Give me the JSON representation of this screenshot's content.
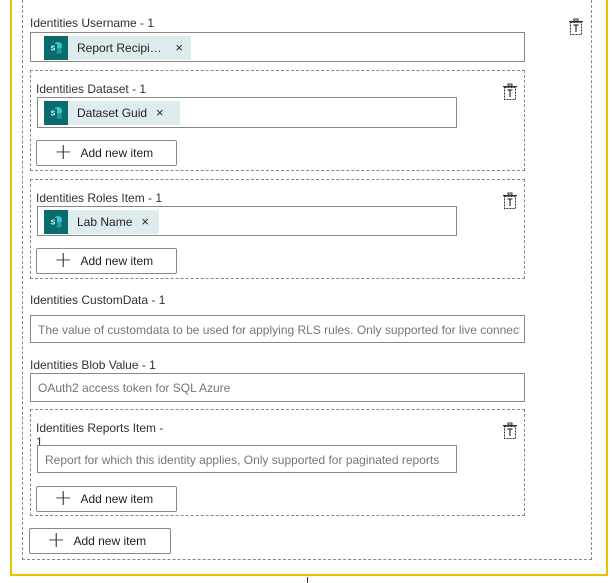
{
  "username": {
    "label": "Identities Username - 1",
    "chip": {
      "text": "Report Recipie…",
      "close": "×"
    }
  },
  "dataset": {
    "label": "Identities Dataset - 1",
    "chip": {
      "text": "Dataset Guid",
      "close": "×"
    },
    "add_label": "Add new item"
  },
  "roles": {
    "label": "Identities Roles Item - 1",
    "chip": {
      "text": "Lab Name",
      "close": "×"
    },
    "add_label": "Add new item"
  },
  "customdata": {
    "label": "Identities CustomData - 1",
    "placeholder": "The value of customdata to be used for applying RLS rules. Only supported for live connections"
  },
  "blob": {
    "label": "Identities Blob Value - 1",
    "placeholder": "OAuth2 access token for SQL Azure"
  },
  "reports": {
    "label": "Identities Reports Item - 1",
    "placeholder": "Report for which this identity applies, Only supported for paginated reports",
    "add_label": "Add new item"
  },
  "outer_add_label": "Add new item",
  "icons": {
    "delete": "delete-icon",
    "sharepoint": "sharepoint-icon",
    "plus": "plus-icon"
  },
  "colors": {
    "accent_border": "#e8c200",
    "chip_bg": "#deecf0",
    "chip_icon_bg": "#0b6a6c"
  }
}
